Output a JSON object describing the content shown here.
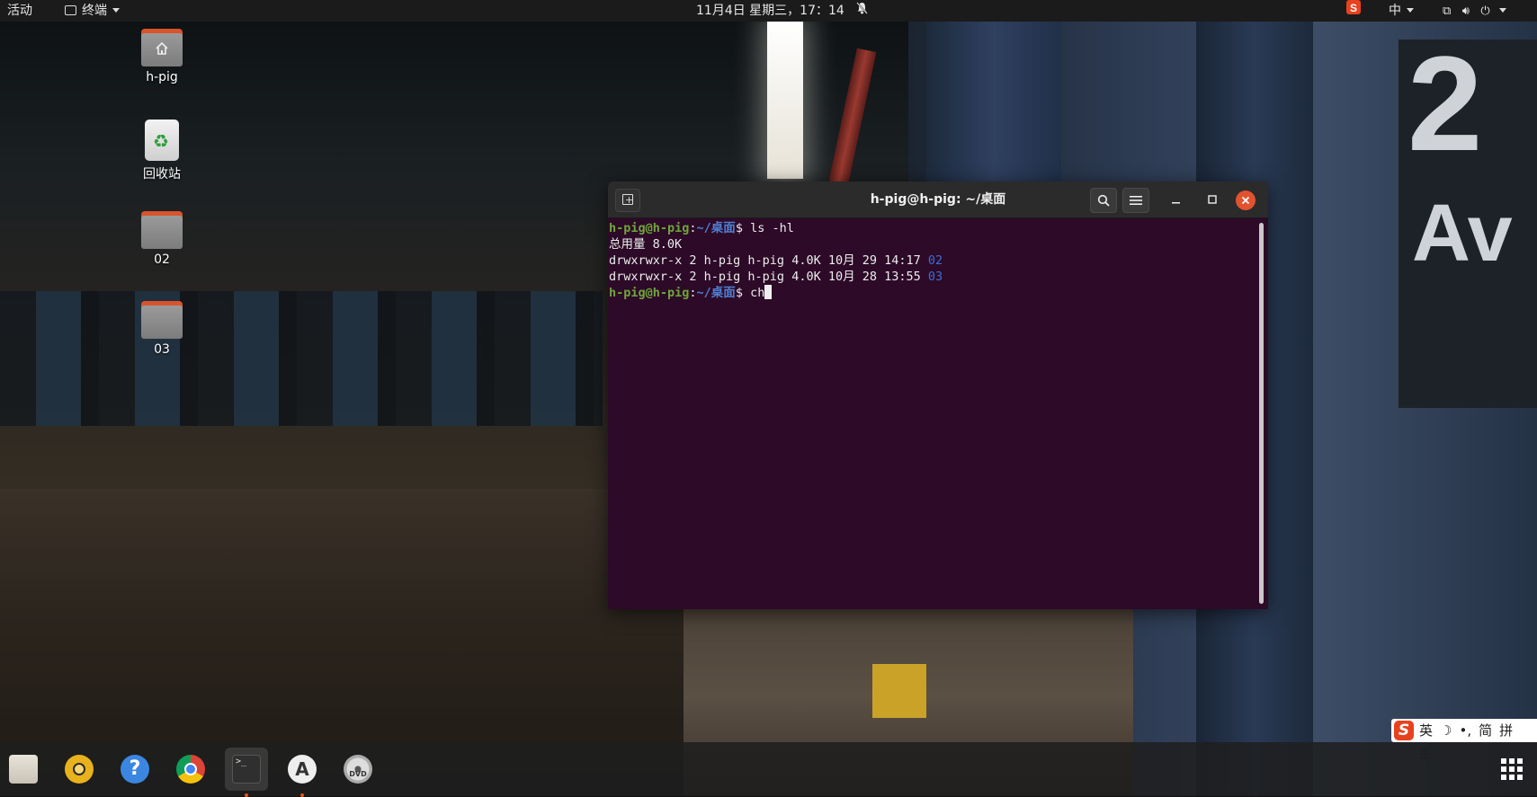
{
  "topbar": {
    "activities": "活动",
    "app_name": "终端",
    "clock": "11月4日 星期三，17：14",
    "ime_indicator": "中",
    "icons": [
      "sogou-icon",
      "network-icon",
      "volume-icon",
      "power-icon"
    ]
  },
  "desktop": {
    "icons": [
      {
        "label": "h-pig",
        "type": "home-folder"
      },
      {
        "label": "回收站",
        "type": "trash"
      },
      {
        "label": "02",
        "type": "folder"
      },
      {
        "label": "03",
        "type": "folder"
      }
    ]
  },
  "terminal": {
    "title": "h-pig@h-pig: ~/桌面",
    "prompt_user": "h-pig@h-pig",
    "prompt_sep": ":",
    "prompt_path": "~/桌面",
    "prompt_dollar": "$",
    "cmd1": " ls -hl",
    "total_line": "总用量 8.0K",
    "rows": [
      {
        "meta": "drwxrwxr-x 2 h-pig h-pig 4.0K 10月 29 14:17 ",
        "name": "02"
      },
      {
        "meta": "drwxrwxr-x 2 h-pig h-pig 4.0K 10月 28 13:55 ",
        "name": "03"
      }
    ],
    "cmd2": " ch"
  },
  "ime_bar": {
    "items": [
      "英",
      "☽",
      "•,",
      "简",
      "拼",
      "⊞"
    ]
  },
  "dock": {
    "apps": [
      "files",
      "rhythmbox",
      "help",
      "chrome",
      "terminal",
      "software-updater",
      "dvd"
    ],
    "dvd_label": "DVD"
  },
  "colors": {
    "terminal_bg": "#2c0a28",
    "prompt_user": "#6fa53a",
    "prompt_path": "#4f7fd3",
    "close_button": "#e1532f",
    "accent_dot": "#e95420"
  }
}
